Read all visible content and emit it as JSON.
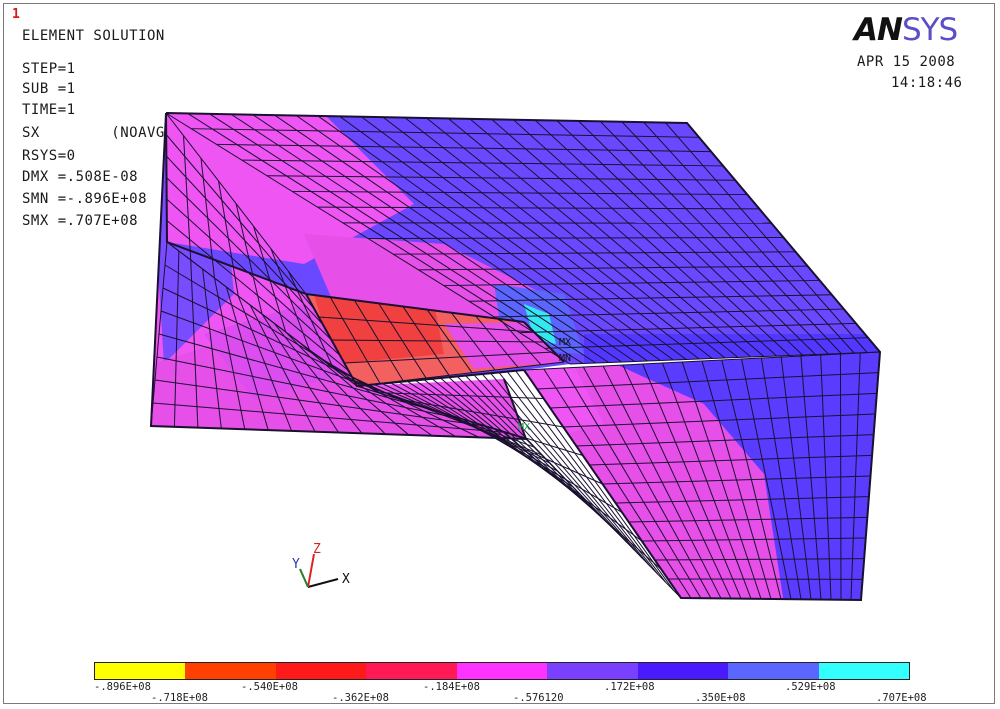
{
  "window_number": "1",
  "logo": {
    "an": "AN",
    "sys": "SYS"
  },
  "header": {
    "title": "ELEMENT SOLUTION",
    "date": "APR 15 2008",
    "time": "14:18:46"
  },
  "info_lines": {
    "step": "STEP=1",
    "sub": "SUB =1",
    "time": "TIME=1",
    "sx": "SX        (NOAVG)",
    "rsys": "RSYS=0",
    "dmx": "DMX =.508E-08",
    "smn": "SMN =-.896E+08",
    "smx": "SMX =.707E+08"
  },
  "triad": {
    "x": "X",
    "y": "Y",
    "z": "Z"
  },
  "node_labels": {
    "mx": "MX",
    "mn": "MN",
    "mx2": "MX"
  },
  "legend": {
    "colors": [
      "#ffff00",
      "#ff4000",
      "#ff1a1a",
      "#ff1a55",
      "#ff33ff",
      "#7a40ff",
      "#4a1aff",
      "#5a66ff",
      "#33ffff"
    ],
    "ticks_top": [
      "-.896E+08",
      "-.540E+08",
      "-.184E+08",
      ".172E+08",
      ".529E+08"
    ],
    "ticks_bottom": [
      "-.718E+08",
      "-.362E+08",
      "-.576120",
      ".350E+08",
      ".707E+08"
    ]
  },
  "colors": {
    "mesh_line": "#1a1030",
    "pink": "#ee55f2",
    "magenta": "#e844e8",
    "violet": "#7250ff",
    "blue": "#5a3cff",
    "red": "#f04848",
    "cyan": "#33e8f0",
    "logo_sys": "#5a4fc7",
    "window_number": "#e01818"
  }
}
